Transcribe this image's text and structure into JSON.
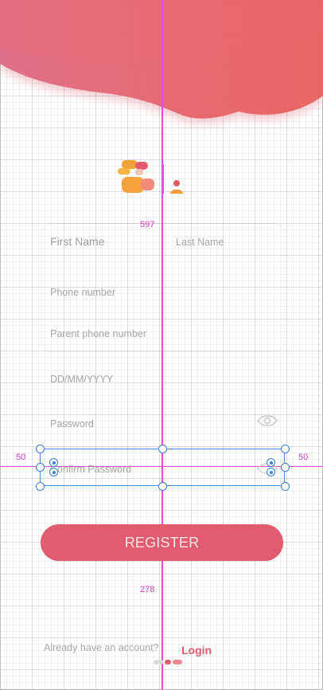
{
  "form": {
    "first_name_placeholder": "First Name",
    "last_name_placeholder": "Last Name",
    "phone_placeholder": "Phone number",
    "parent_phone_placeholder": "Parent phone number",
    "dob_placeholder": "DD/MM/YYYY",
    "password_placeholder": "Password",
    "confirm_password_placeholder": "Confirm Password"
  },
  "register_button_label": "REGISTER",
  "footer": {
    "already_text": "Already have an account?",
    "login_label": "Login"
  },
  "design_overlay": {
    "width_readout": "597",
    "height_readout": "278",
    "left_margin": "50",
    "right_margin": "50"
  },
  "colors": {
    "brand": "#e05c6e",
    "header_gradient_start": "#e06a82",
    "header_gradient_end": "#e85f5a",
    "guide": "#e24cd6",
    "selection": "#4a8fe0"
  },
  "icons": [
    "app-logo-icon",
    "eye-icon",
    "eye-icon",
    "anchor-icon"
  ]
}
